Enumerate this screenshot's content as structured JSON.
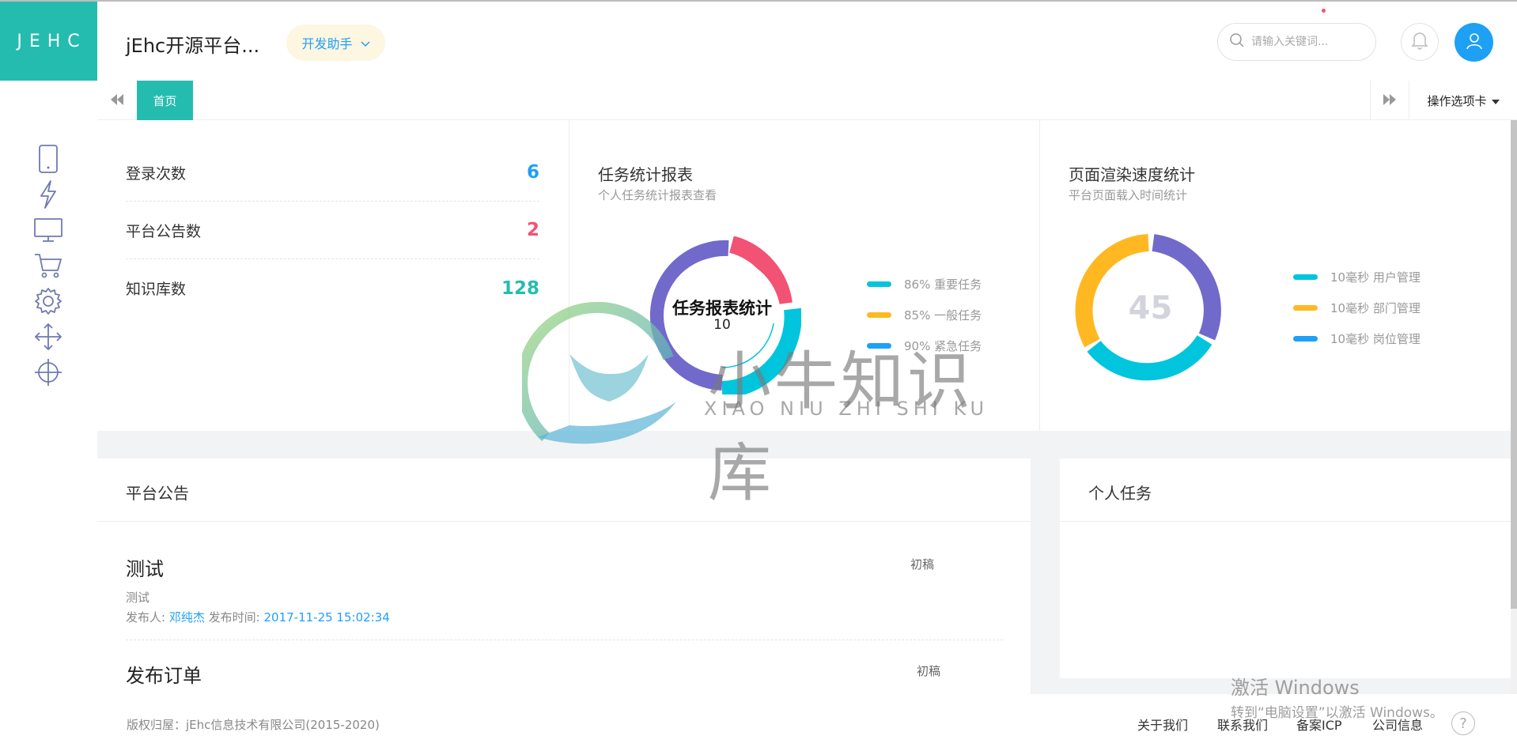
{
  "brand": {
    "logo": "JEHC",
    "app_title": "jEhc开源平台..."
  },
  "header": {
    "dev_button": "开发助手",
    "search_placeholder": "请输入关键词...",
    "colors": {
      "accent": "#25bcb0",
      "user": "#1ea0f5",
      "notify_dot": "#f25274"
    }
  },
  "sidebar": {
    "icons": [
      "tablet-icon",
      "lightning-icon",
      "monitor-icon",
      "cart-icon",
      "gear-icon",
      "move-icon",
      "crosshair-icon"
    ]
  },
  "tabs": {
    "home": "首页",
    "ops": "操作选项卡"
  },
  "stats": [
    {
      "label": "登录次数",
      "value": "6",
      "color": "#1ea0f5"
    },
    {
      "label": "平台公告数",
      "value": "2",
      "color": "#f25274"
    },
    {
      "label": "知识库数",
      "value": "128",
      "color": "#25bcb0"
    }
  ],
  "task_report": {
    "title": "任务统计报表",
    "subtitle": "个人任务统计报表查看",
    "center_title": "任务报表统计",
    "center_value": "10",
    "legend": [
      {
        "label": "86% 重要任务",
        "color": "#00c5dc"
      },
      {
        "label": "85% 一般任务",
        "color": "#ffb822"
      },
      {
        "label": "90% 紧急任务",
        "color": "#1ea0f5"
      }
    ]
  },
  "render_speed": {
    "title": "页面渲染速度统计",
    "subtitle": "平台页面载入时间统计",
    "center_value": "45",
    "legend": [
      {
        "label": "10毫秒 用户管理",
        "color": "#00c5dc"
      },
      {
        "label": "10毫秒 部门管理",
        "color": "#ffb822"
      },
      {
        "label": "10毫秒 岗位管理",
        "color": "#1ea0f5"
      }
    ]
  },
  "announcements": {
    "title": "平台公告",
    "items": [
      {
        "title": "测试",
        "badge": "初稿",
        "desc": "测试",
        "publisher_label": "发布人:",
        "publisher": "邓纯杰",
        "time_label": "发布时间:",
        "time": "2017-11-25 15:02:34"
      },
      {
        "title": "发布订单",
        "badge": "初稿"
      }
    ]
  },
  "personal_tasks": {
    "title": "个人任务"
  },
  "watermark": {
    "text": "小牛知识库",
    "sub": "XIAO NIU ZHI SHI KU"
  },
  "footer": {
    "copyright": "版权归屋：jEhc信息技术有限公司(2015-2020)",
    "links": [
      "关于我们",
      "联系我们",
      "备案ICP",
      "公司信息"
    ],
    "help": "?"
  },
  "os_activation": {
    "line1": "激活 Windows",
    "line2": "转到“电脑设置”以激活 Windows。"
  }
}
